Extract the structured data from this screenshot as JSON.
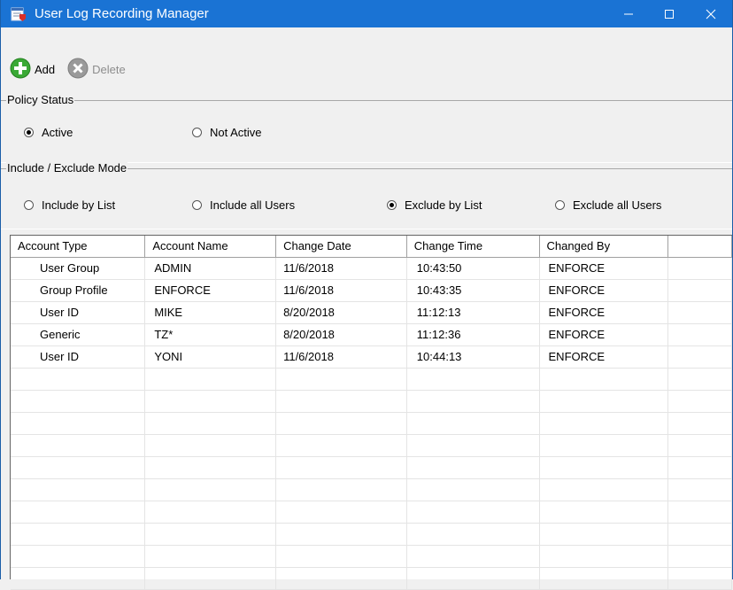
{
  "window": {
    "title": "User Log Recording Manager",
    "minimize_glyph": "—",
    "maximize_glyph": "☐",
    "close_glyph": "✕"
  },
  "toolbar": {
    "add_label": "Add",
    "delete_label": "Delete"
  },
  "policy_status": {
    "legend": "Policy Status",
    "options": [
      {
        "label": "Active",
        "selected": true
      },
      {
        "label": "Not Active",
        "selected": false
      }
    ]
  },
  "mode": {
    "legend": "Include / Exclude Mode",
    "options": [
      {
        "label": "Include by List",
        "selected": false
      },
      {
        "label": "Include all Users",
        "selected": false
      },
      {
        "label": "Exclude by List",
        "selected": true
      },
      {
        "label": "Exclude all Users",
        "selected": false
      }
    ]
  },
  "grid": {
    "columns": [
      "Account Type",
      "Account Name",
      "Change Date",
      "Change Time",
      "Changed By",
      ""
    ],
    "rows": [
      [
        "User Group",
        "ADMIN",
        "11/6/2018",
        "10:43:50",
        "ENFORCE"
      ],
      [
        "Group Profile",
        "ENFORCE",
        "11/6/2018",
        "10:43:35",
        "ENFORCE"
      ],
      [
        "User ID",
        "MIKE",
        "8/20/2018",
        "11:12:13",
        "ENFORCE"
      ],
      [
        "Generic",
        "TZ*",
        "8/20/2018",
        "11:12:36",
        "ENFORCE"
      ],
      [
        "User ID",
        "YONI",
        "11/6/2018",
        "10:44:13",
        "ENFORCE"
      ]
    ],
    "empty_rows": 10
  },
  "colors": {
    "titlebar": "#1a73d4",
    "add_icon": "#3aa935",
    "delete_icon_disabled": "#9a9a9a"
  },
  "icons": {
    "app": "log-manager-icon",
    "add": "plus-circle-icon",
    "delete": "x-circle-icon"
  }
}
